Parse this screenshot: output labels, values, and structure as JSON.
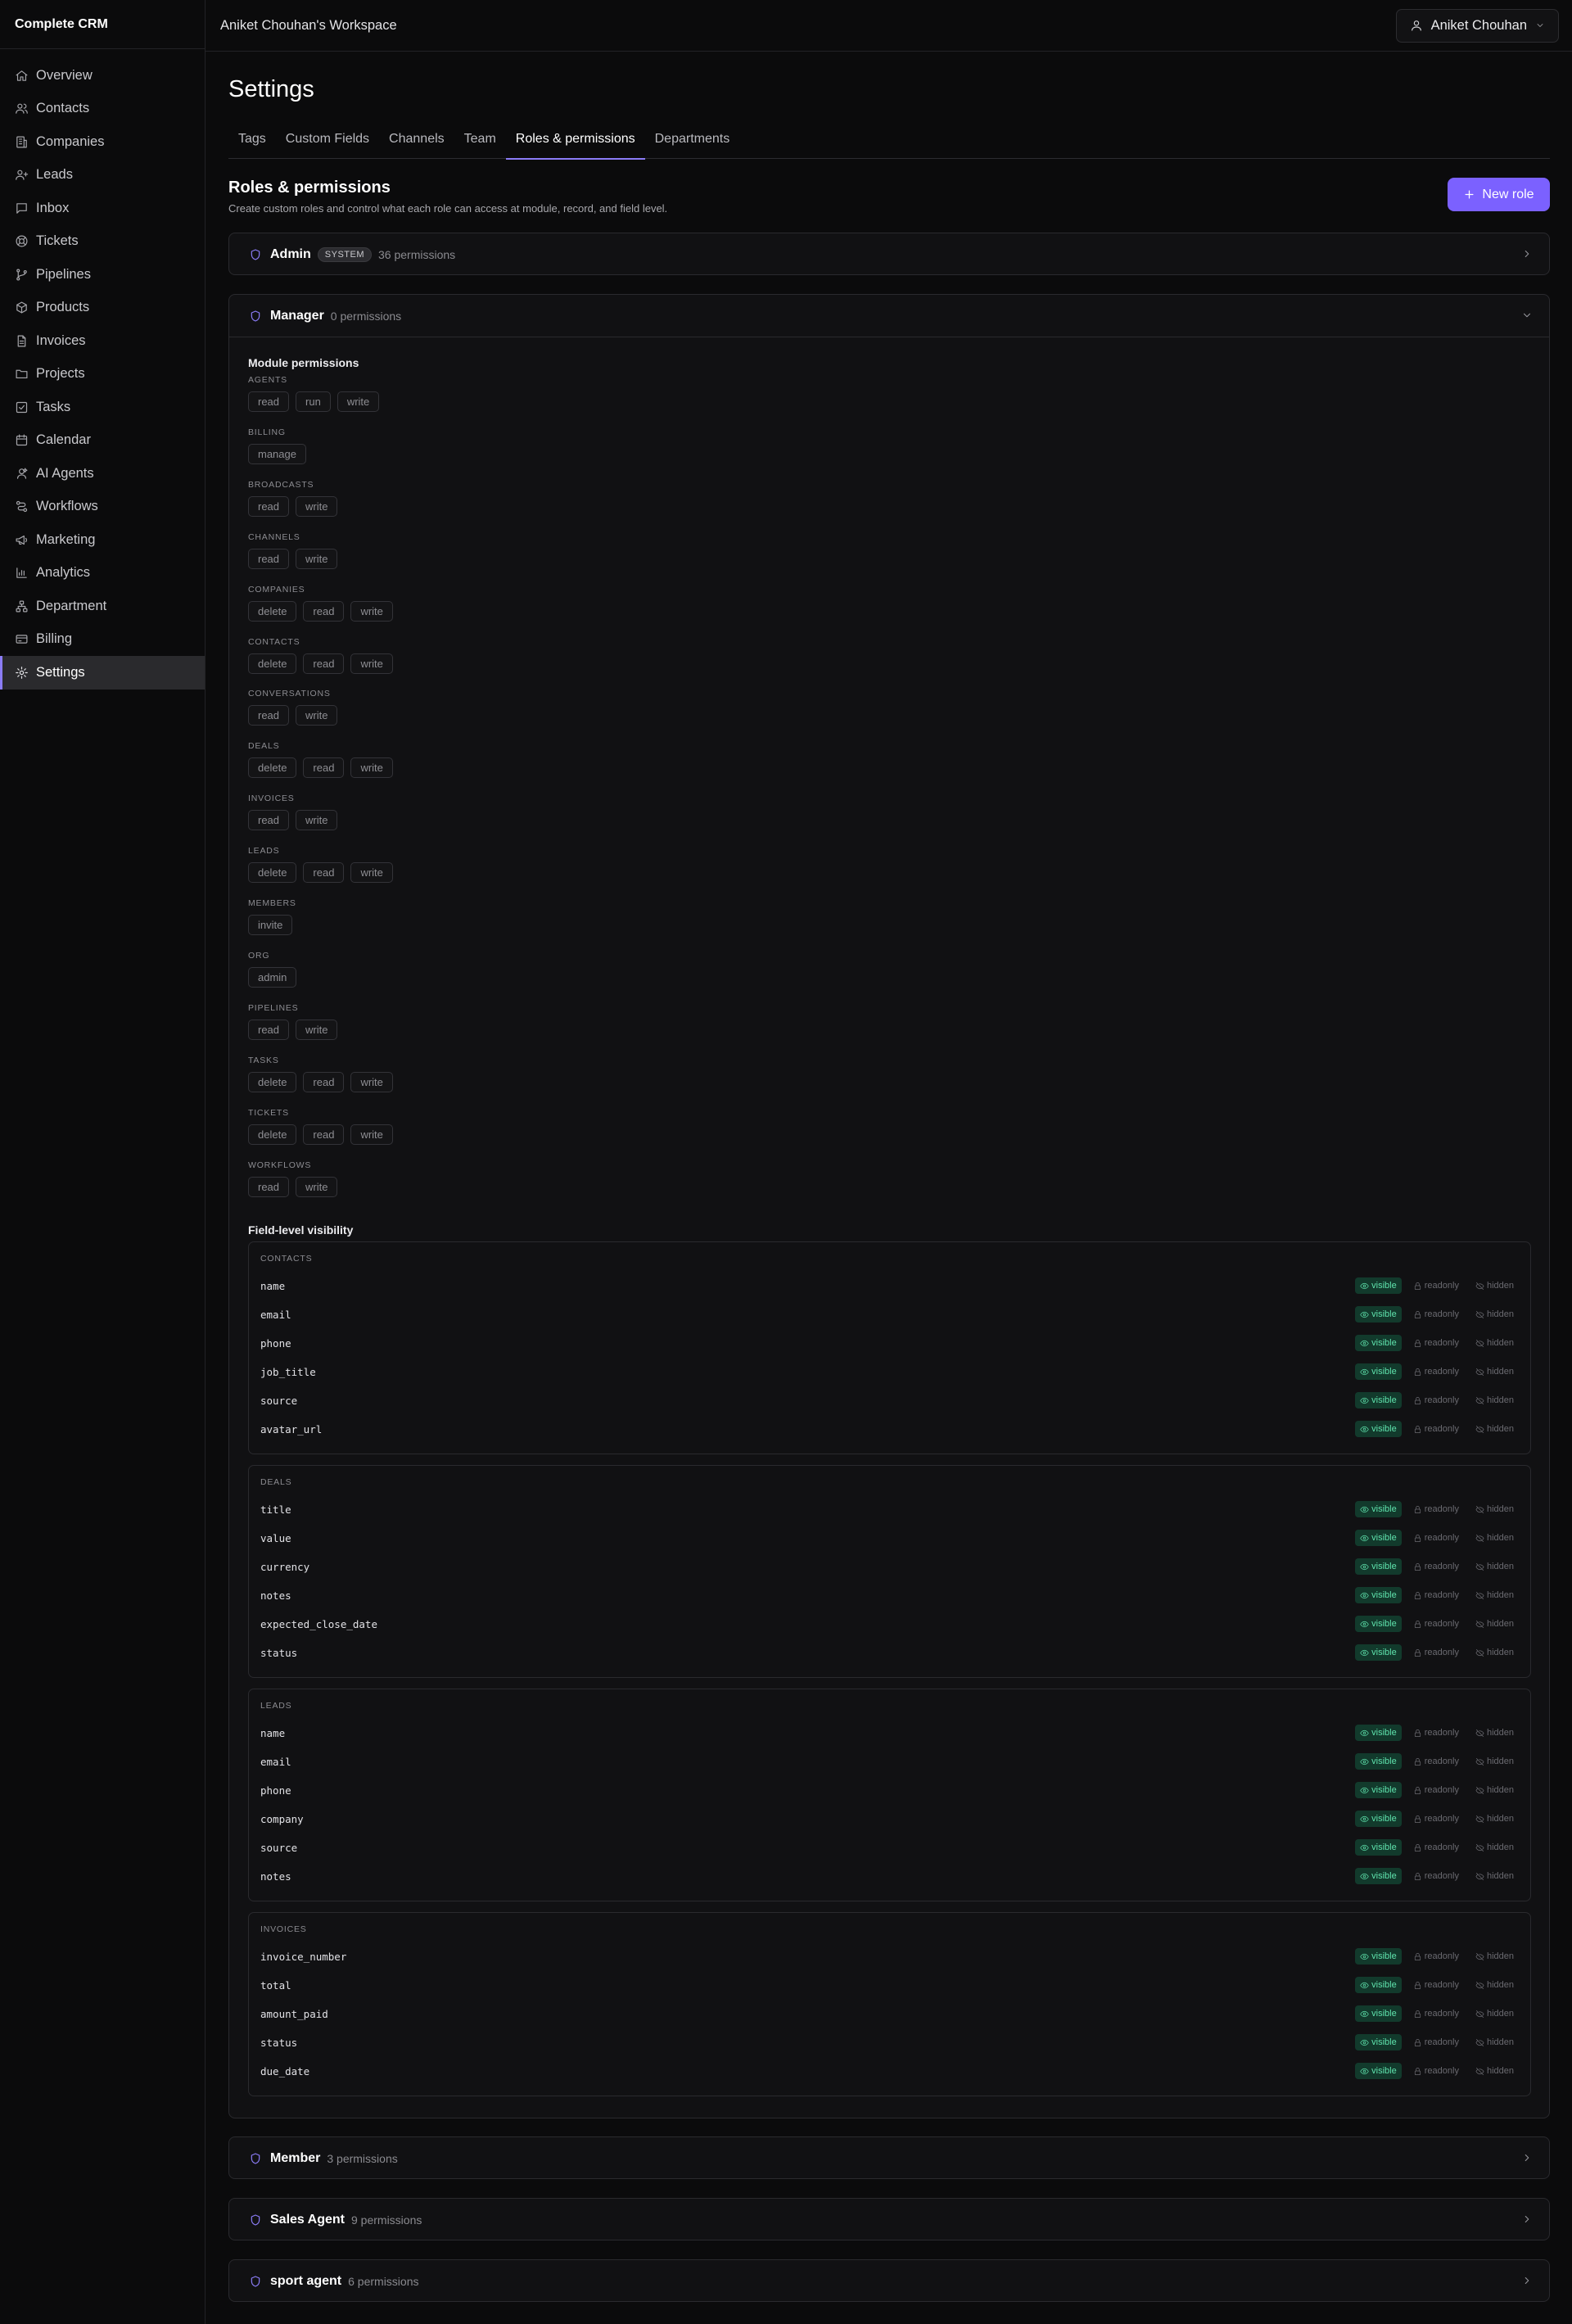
{
  "app": {
    "name": "Complete CRM",
    "workspace": "Aniket Chouhan's Workspace",
    "user": "Aniket Chouhan"
  },
  "nav": [
    {
      "label": "Overview",
      "icon": "home-icon"
    },
    {
      "label": "Contacts",
      "icon": "users-icon"
    },
    {
      "label": "Companies",
      "icon": "building-icon"
    },
    {
      "label": "Leads",
      "icon": "user-plus-icon"
    },
    {
      "label": "Inbox",
      "icon": "message-icon"
    },
    {
      "label": "Tickets",
      "icon": "lifebuoy-icon"
    },
    {
      "label": "Pipelines",
      "icon": "git-branch-icon"
    },
    {
      "label": "Products",
      "icon": "package-icon"
    },
    {
      "label": "Invoices",
      "icon": "file-text-icon"
    },
    {
      "label": "Projects",
      "icon": "folder-icon"
    },
    {
      "label": "Tasks",
      "icon": "check-square-icon"
    },
    {
      "label": "Calendar",
      "icon": "calendar-icon"
    },
    {
      "label": "AI Agents",
      "icon": "bot-icon"
    },
    {
      "label": "Workflows",
      "icon": "workflow-icon"
    },
    {
      "label": "Marketing",
      "icon": "megaphone-icon"
    },
    {
      "label": "Analytics",
      "icon": "bar-chart-icon"
    },
    {
      "label": "Department",
      "icon": "network-icon"
    },
    {
      "label": "Billing",
      "icon": "credit-card-icon"
    },
    {
      "label": "Settings",
      "icon": "gear-icon",
      "active": true
    }
  ],
  "page": {
    "title": "Settings"
  },
  "tabs": [
    {
      "label": "Tags"
    },
    {
      "label": "Custom Fields"
    },
    {
      "label": "Channels"
    },
    {
      "label": "Team"
    },
    {
      "label": "Roles & permissions",
      "active": true
    },
    {
      "label": "Departments"
    }
  ],
  "section": {
    "title": "Roles & permissions",
    "subtitle": "Create custom roles and control what each role can access at module, record, and field level.",
    "new_role_label": "New role"
  },
  "roles": [
    {
      "name": "Admin",
      "badge": "SYSTEM",
      "count": "36 permissions",
      "expanded": false
    },
    {
      "name": "Manager",
      "count": "0 permissions",
      "expanded": true
    },
    {
      "name": "Member",
      "count": "3 permissions",
      "expanded": false
    },
    {
      "name": "Sales Agent",
      "count": "9 permissions",
      "expanded": false
    },
    {
      "name": "sport agent",
      "count": "6 permissions",
      "expanded": false
    }
  ],
  "manager": {
    "module_heading": "Module permissions",
    "modules": [
      {
        "name": "AGENTS",
        "perms": [
          "read",
          "run",
          "write"
        ]
      },
      {
        "name": "BILLING",
        "perms": [
          "manage"
        ]
      },
      {
        "name": "BROADCASTS",
        "perms": [
          "read",
          "write"
        ]
      },
      {
        "name": "CHANNELS",
        "perms": [
          "read",
          "write"
        ]
      },
      {
        "name": "COMPANIES",
        "perms": [
          "delete",
          "read",
          "write"
        ]
      },
      {
        "name": "CONTACTS",
        "perms": [
          "delete",
          "read",
          "write"
        ]
      },
      {
        "name": "CONVERSATIONS",
        "perms": [
          "read",
          "write"
        ]
      },
      {
        "name": "DEALS",
        "perms": [
          "delete",
          "read",
          "write"
        ]
      },
      {
        "name": "INVOICES",
        "perms": [
          "read",
          "write"
        ]
      },
      {
        "name": "LEADS",
        "perms": [
          "delete",
          "read",
          "write"
        ]
      },
      {
        "name": "MEMBERS",
        "perms": [
          "invite"
        ]
      },
      {
        "name": "ORG",
        "perms": [
          "admin"
        ]
      },
      {
        "name": "PIPELINES",
        "perms": [
          "read",
          "write"
        ]
      },
      {
        "name": "TASKS",
        "perms": [
          "delete",
          "read",
          "write"
        ]
      },
      {
        "name": "TICKETS",
        "perms": [
          "delete",
          "read",
          "write"
        ]
      },
      {
        "name": "WORKFLOWS",
        "perms": [
          "read",
          "write"
        ]
      }
    ],
    "field_heading": "Field-level visibility",
    "visibility_options": [
      "visible",
      "readonly",
      "hidden"
    ],
    "field_groups": [
      {
        "name": "CONTACTS",
        "fields": [
          "name",
          "email",
          "phone",
          "job_title",
          "source",
          "avatar_url"
        ]
      },
      {
        "name": "DEALS",
        "fields": [
          "title",
          "value",
          "currency",
          "notes",
          "expected_close_date",
          "status"
        ]
      },
      {
        "name": "LEADS",
        "fields": [
          "name",
          "email",
          "phone",
          "company",
          "source",
          "notes"
        ]
      },
      {
        "name": "INVOICES",
        "fields": [
          "invoice_number",
          "total",
          "amount_paid",
          "status",
          "due_date"
        ]
      }
    ],
    "selected_visibility": "visible"
  },
  "colors": {
    "accent": "#7b61ff",
    "visible_bg": "#123a2c",
    "visible_text": "#5fe3ad"
  }
}
